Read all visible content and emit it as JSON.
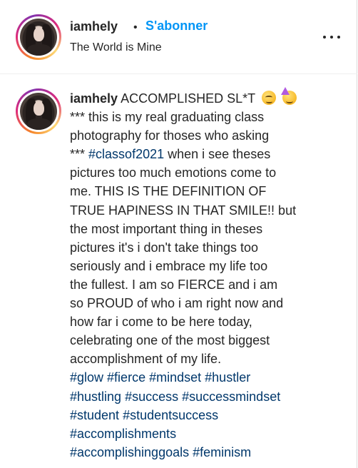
{
  "header": {
    "username": "iamhely",
    "separator": "•",
    "follow_label": "S'abonner",
    "subtitle": "The World is Mine"
  },
  "caption": {
    "username": "iamhely",
    "first_line_text": "ACCOMPLISHED SL*T",
    "emojis": [
      "smirking-face",
      "partying-face"
    ],
    "lines": [
      "*** this is my real graduating class",
      "photography for thoses who asking"
    ],
    "line_before_tag": "***",
    "tag_inline": "#classof2021",
    "line_after_tag": "when i see theses",
    "body_lines": [
      "pictures too much emotions come to",
      "me. THIS IS THE DEFINITION OF",
      "TRUE HAPINESS IN THAT SMILE!! but",
      "the most important thing in theses",
      "pictures it's i don't take things too",
      "seriously and i embrace my life too",
      "the fullest. I am so FIERCE and i am",
      "so PROUD of who i am right now and",
      "how far i come to be here today,",
      "celebrating one of the most biggest",
      "accomplishment of my life."
    ],
    "hashtag_lines": [
      [
        "#glow",
        "#fierce",
        "#mindset",
        "#hustler"
      ],
      [
        "#hustling",
        "#success",
        "#successmindset"
      ],
      [
        "#student",
        "#studentsuccess"
      ],
      [
        "#accomplishments"
      ],
      [
        "#accomplishinggoals",
        "#feminism"
      ]
    ]
  },
  "colors": {
    "link_blue": "#0095f6",
    "hashtag_blue": "#00376b",
    "text": "#262626"
  },
  "icons": {
    "more_options": "more-horizontal-icon"
  }
}
